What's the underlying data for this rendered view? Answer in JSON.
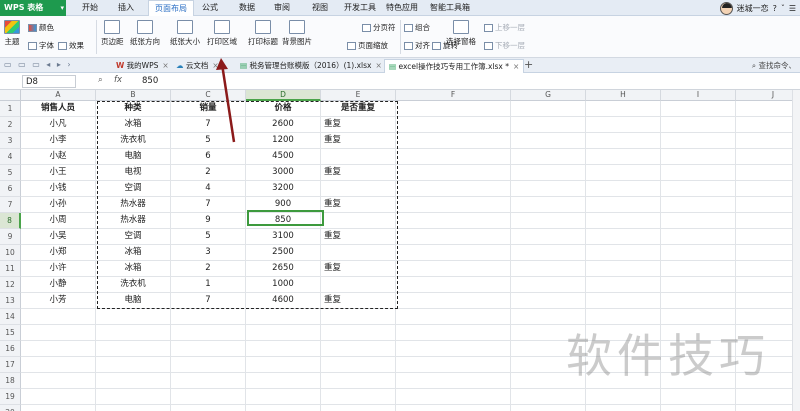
{
  "app": {
    "logo": "WPS 表格"
  },
  "menu": [
    "开始",
    "插入",
    "页面布局",
    "公式",
    "数据",
    "审阅",
    "视图",
    "开发工具",
    "特色应用",
    "智能工具箱"
  ],
  "menu_active_index": 2,
  "user": {
    "name": "迷城一恋"
  },
  "ribbon": {
    "theme": "主题",
    "colors": "颜色",
    "fonts": "字体",
    "effects": "效果",
    "margins": "页边距",
    "orientation": "纸张方向",
    "size": "纸张大小",
    "print_area": "打印区域",
    "print_titles": "打印标题",
    "background": "背景图片",
    "page_break": "分页符",
    "page_zoom": "页面缩放",
    "group": "组合",
    "align": "对齐",
    "rotate": "旋转",
    "selection_pane": "选择窗格",
    "bring_forward": "上移一层",
    "send_backward": "下移一层"
  },
  "tabs": [
    {
      "label": "我的WPS"
    },
    {
      "label": "云文档"
    },
    {
      "label": "税务管理台账模版（2016）(1).xlsx"
    },
    {
      "label": "excel操作技巧专用工作簿.xlsx *"
    }
  ],
  "tabs_active_index": 3,
  "tabs_right": "查找命令、",
  "formula": {
    "cell_ref": "D8",
    "fx": "fx",
    "value": "850"
  },
  "columns": [
    "A",
    "B",
    "C",
    "D",
    "E",
    "F",
    "G",
    "H",
    "I",
    "J"
  ],
  "selected_column": "D",
  "selected_row": 8,
  "rows": [
    "1",
    "2",
    "3",
    "4",
    "5",
    "6",
    "7",
    "8",
    "9",
    "10",
    "11",
    "12",
    "13",
    "14",
    "15",
    "16",
    "17",
    "18",
    "19",
    "20"
  ],
  "table": {
    "headers": [
      "销售人员",
      "种类",
      "销量",
      "价格",
      "是否重复"
    ],
    "data": [
      [
        "小凡",
        "冰箱",
        "7",
        "2600",
        "重复"
      ],
      [
        "小李",
        "洗衣机",
        "5",
        "1200",
        "重复"
      ],
      [
        "小赵",
        "电脑",
        "6",
        "4500",
        ""
      ],
      [
        "小王",
        "电视",
        "2",
        "3000",
        "重复"
      ],
      [
        "小钱",
        "空调",
        "4",
        "3200",
        ""
      ],
      [
        "小孙",
        "热水器",
        "7",
        "900",
        "重复"
      ],
      [
        "小周",
        "热水器",
        "9",
        "850",
        ""
      ],
      [
        "小吴",
        "空调",
        "5",
        "3100",
        "重复"
      ],
      [
        "小郑",
        "冰箱",
        "3",
        "2500",
        ""
      ],
      [
        "小许",
        "冰箱",
        "2",
        "2650",
        "重复"
      ],
      [
        "小静",
        "洗衣机",
        "1",
        "1000",
        ""
      ],
      [
        "小芳",
        "电脑",
        "7",
        "4600",
        "重复"
      ]
    ]
  },
  "watermark": "软件技巧",
  "colors": {
    "accent_green": "#1e9a4e",
    "annotation_arrow": "#8b1a1a",
    "selection": "#3d9a3d"
  }
}
